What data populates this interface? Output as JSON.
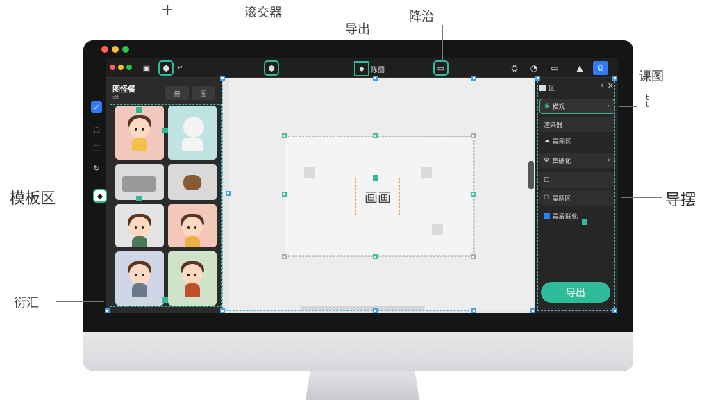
{
  "annotations": {
    "top_plus": "+",
    "top_left_label": "滚交器",
    "top_center_label": "导出",
    "top_right_label": "降治",
    "right_top_label": "课图",
    "right_small": "t t",
    "left_mid_label": "模板区",
    "right_mid_label": "导摆",
    "left_bottom_label": "衍汇"
  },
  "toolbar": {
    "center_label": "陈图",
    "buttons": [
      "users-icon",
      "shapes-icon",
      "monitor-icon",
      "person-icon",
      "layers-icon"
    ]
  },
  "template_panel": {
    "title": "图怪餐",
    "subtitle": "ctt",
    "tabs": [
      "冊",
      "图"
    ]
  },
  "canvas": {
    "center_label": "画画"
  },
  "right_panel": {
    "header_title": "区",
    "rows": [
      {
        "label": "模观"
      },
      {
        "label": "渲染器"
      },
      {
        "label": "晨图区"
      },
      {
        "label": "集破化"
      },
      {
        "label": ""
      },
      {
        "label": "晨题区"
      },
      {
        "label": "晨殿联化"
      }
    ],
    "export_label": "导出"
  },
  "colors": {
    "accent": "#2dbb9a",
    "blue": "#2f7cf6",
    "screen_bg": "#2a2a2a",
    "canvas_bg": "#ededed"
  }
}
